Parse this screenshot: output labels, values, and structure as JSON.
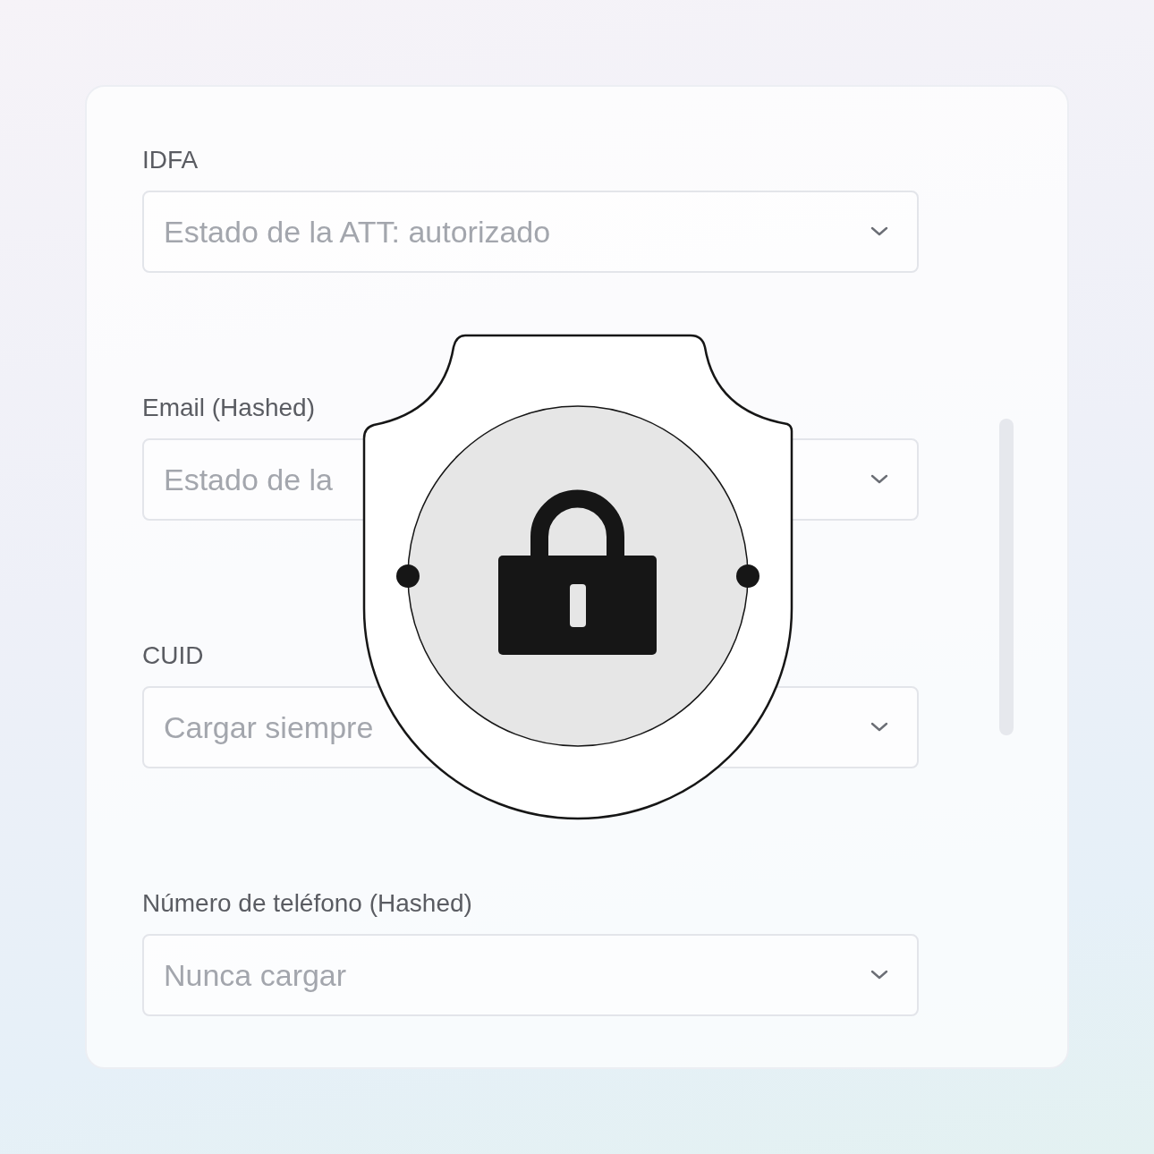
{
  "fields": [
    {
      "label": "IDFA",
      "value": "Estado de la ATT: autorizado"
    },
    {
      "label": "Email (Hashed)",
      "value": "Estado de la"
    },
    {
      "label": "CUID",
      "value": "Cargar siempre"
    },
    {
      "label": "Número de teléfono (Hashed)",
      "value": "Nunca cargar"
    }
  ]
}
